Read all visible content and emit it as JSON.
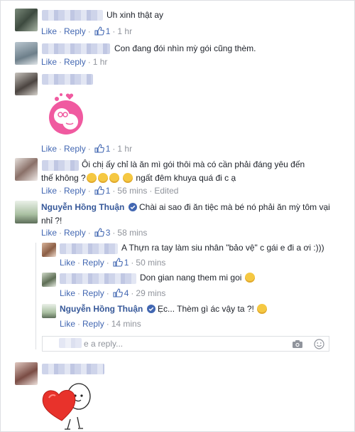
{
  "actions": {
    "like": "Like",
    "reply": "Reply"
  },
  "comments": [
    {
      "text": "Uh xinh thật ay",
      "likes": "1",
      "time": "1 hr"
    },
    {
      "text": "Con đang đói nhìn mỳ gói cũng thèm.",
      "time": "1 hr"
    },
    {
      "text": "",
      "likes": "1",
      "time": "1 hr"
    },
    {
      "text_line1": "Ôi chị ấy chỉ là ăn mì gói thôi mà có cần phải đáng yêu đến",
      "text_line2_a": "thế không ?",
      "text_line2_b": "ngất đêm khuya quá đi c ạ",
      "likes": "1",
      "time": "56 mins",
      "edited": "Edited"
    },
    {
      "name": "Nguyễn Hồng Thuận",
      "text_line1": "Chài ai sao đi ăn tiệc mà bé nó phải ăn mỳ tôm vại",
      "text_line2": "nhỉ ?!",
      "likes": "3",
      "time": "58 mins"
    }
  ],
  "replies": [
    {
      "text": "A Thựn ra tay làm siu nhân \"bảo vệ\" c gái e đi a ơi :)))",
      "likes": "1",
      "time": "50 mins"
    },
    {
      "text": "Don gian nang them mi goi",
      "likes": "4",
      "time": "29 mins"
    },
    {
      "name": "Nguyễn Hồng Thuận",
      "text": "Ẹc... Thèm gì ác vậy ta ?!",
      "time": "14 mins"
    }
  ],
  "reply_box": {
    "placeholder": "e a reply..."
  },
  "icons": [
    "like-icon",
    "verified-badge-icon",
    "camera-icon",
    "emoji-icon",
    "avatar"
  ]
}
